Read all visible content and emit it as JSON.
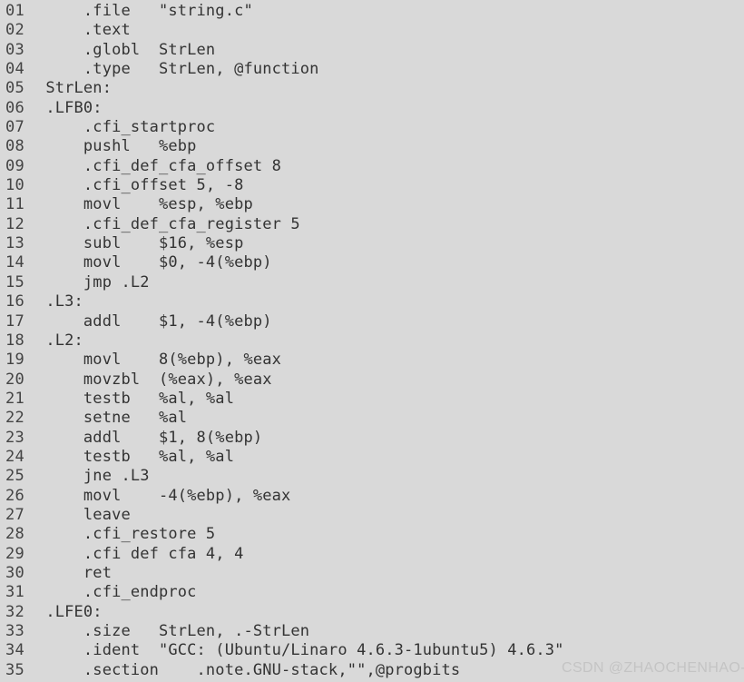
{
  "document": {
    "type": "assembly-source-listing",
    "background_color": "#d9d9d9",
    "text_color": "#333333",
    "line_number_color": "#444444",
    "lines": [
      {
        "number": "01",
        "content": "     .file   \"string.c\""
      },
      {
        "number": "02",
        "content": "     .text"
      },
      {
        "number": "03",
        "content": "     .globl  StrLen"
      },
      {
        "number": "04",
        "content": "     .type   StrLen, @function"
      },
      {
        "number": "05",
        "content": " StrLen:"
      },
      {
        "number": "06",
        "content": " .LFB0:"
      },
      {
        "number": "07",
        "content": "     .cfi_startproc"
      },
      {
        "number": "08",
        "content": "     pushl   %ebp"
      },
      {
        "number": "09",
        "content": "     .cfi_def_cfa_offset 8"
      },
      {
        "number": "10",
        "content": "     .cfi_offset 5, -8"
      },
      {
        "number": "11",
        "content": "     movl    %esp, %ebp"
      },
      {
        "number": "12",
        "content": "     .cfi_def_cfa_register 5"
      },
      {
        "number": "13",
        "content": "     subl    $16, %esp"
      },
      {
        "number": "14",
        "content": "     movl    $0, -4(%ebp)"
      },
      {
        "number": "15",
        "content": "     jmp .L2"
      },
      {
        "number": "16",
        "content": " .L3:"
      },
      {
        "number": "17",
        "content": "     addl    $1, -4(%ebp)"
      },
      {
        "number": "18",
        "content": " .L2:"
      },
      {
        "number": "19",
        "content": "     movl    8(%ebp), %eax"
      },
      {
        "number": "20",
        "content": "     movzbl  (%eax), %eax"
      },
      {
        "number": "21",
        "content": "     testb   %al, %al"
      },
      {
        "number": "22",
        "content": "     setne   %al"
      },
      {
        "number": "23",
        "content": "     addl    $1, 8(%ebp)"
      },
      {
        "number": "24",
        "content": "     testb   %al, %al"
      },
      {
        "number": "25",
        "content": "     jne .L3"
      },
      {
        "number": "26",
        "content": "     movl    -4(%ebp), %eax"
      },
      {
        "number": "27",
        "content": "     leave"
      },
      {
        "number": "28",
        "content": "     .cfi_restore 5"
      },
      {
        "number": "29",
        "content": "     .cfi def cfa 4, 4"
      },
      {
        "number": "30",
        "content": "     ret"
      },
      {
        "number": "31",
        "content": "     .cfi_endproc"
      },
      {
        "number": "32",
        "content": " .LFE0:"
      },
      {
        "number": "33",
        "content": "     .size   StrLen, .-StrLen"
      },
      {
        "number": "34",
        "content": "     .ident  \"GCC: (Ubuntu/Linaro 4.6.3-1ubuntu5) 4.6.3\""
      },
      {
        "number": "35",
        "content": "     .section    .note.GNU-stack,\"\",@progbits"
      }
    ]
  },
  "watermark": {
    "text": "CSDN @ZHAOCHENHAO-",
    "color": "#c4c4c4"
  }
}
